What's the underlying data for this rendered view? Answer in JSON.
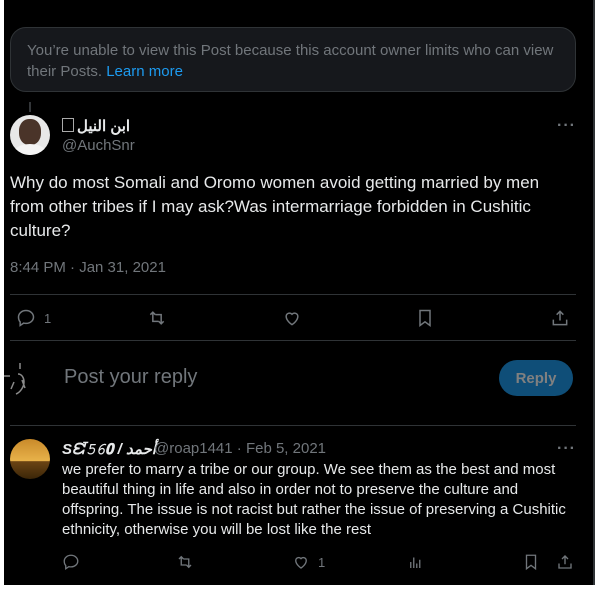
{
  "restricted_notice": {
    "text": "You’re unable to view this Post because this account owner limits who can view their Posts.",
    "link": "Learn more"
  },
  "post": {
    "author_name": "ابن النيل",
    "handle": "@AuchSnr",
    "text": "Why do most Somali and Oromo women avoid getting married by men from other tribes if I may ask?Was intermarriage forbidden in Cushitic culture?",
    "timestamp": "8:44 PM · Jan 31, 2021",
    "reply_count": "1",
    "more": "···"
  },
  "composer": {
    "placeholder": "Post your reply",
    "button": "Reply"
  },
  "reply": {
    "author_name": "Sᘿ𝟻𝟼𝟎 / أحمد",
    "handle_date": "@roap1441 · Feb 5, 2021",
    "text": "we prefer to marry a tribe or our group. We see them as the best and most beautiful thing in life and also in order not to preserve the culture and offspring. The issue is not racist but rather the issue of preserving a Cushitic ethnicity, otherwise you will be lost like the rest",
    "like_count": "1",
    "more": "···"
  },
  "colors": {
    "background": "#000000",
    "text": "#e7e9ea",
    "muted": "#71767b",
    "accent": "#1d9bf0",
    "border": "#2f3336"
  },
  "icons": [
    "reply-icon",
    "repost-icon",
    "like-icon",
    "bookmark-icon",
    "share-icon",
    "views-icon",
    "more-icon"
  ]
}
